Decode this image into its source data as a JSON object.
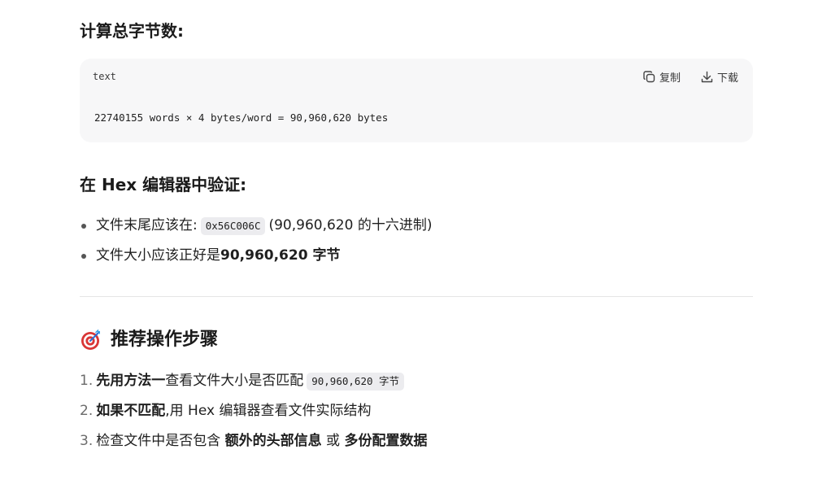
{
  "calc_heading": "计算总字节数:",
  "code_block": {
    "lang": "text",
    "copy_label": "复制",
    "download_label": "下载",
    "line": "22740155 words × 4 bytes/word = 90,960,620 bytes"
  },
  "verify_heading": "在 Hex 编辑器中验证:",
  "bullets": [
    {
      "prefix": "文件末尾应该在:",
      "code": "0x56C006C",
      "suffix": "(90,960,620 的十六进制)"
    },
    {
      "prefix": "文件大小应该正好是 ",
      "bold": "90,960,620 字节"
    }
  ],
  "steps_heading": {
    "icon": "target-icon",
    "text": "推荐操作步骤"
  },
  "steps": [
    {
      "num": "1.",
      "bold": "先用方法一",
      "text": "查看文件大小是否匹配",
      "code": "90,960,620 字节"
    },
    {
      "num": "2.",
      "bold": "如果不匹配",
      "text": ",用 Hex 编辑器查看文件实际结构"
    },
    {
      "num": "3.",
      "text": "检查文件中是否包含 ",
      "bold": "额外的头部信息",
      "mid": " 或 ",
      "bold2": "多份配置数据"
    }
  ]
}
